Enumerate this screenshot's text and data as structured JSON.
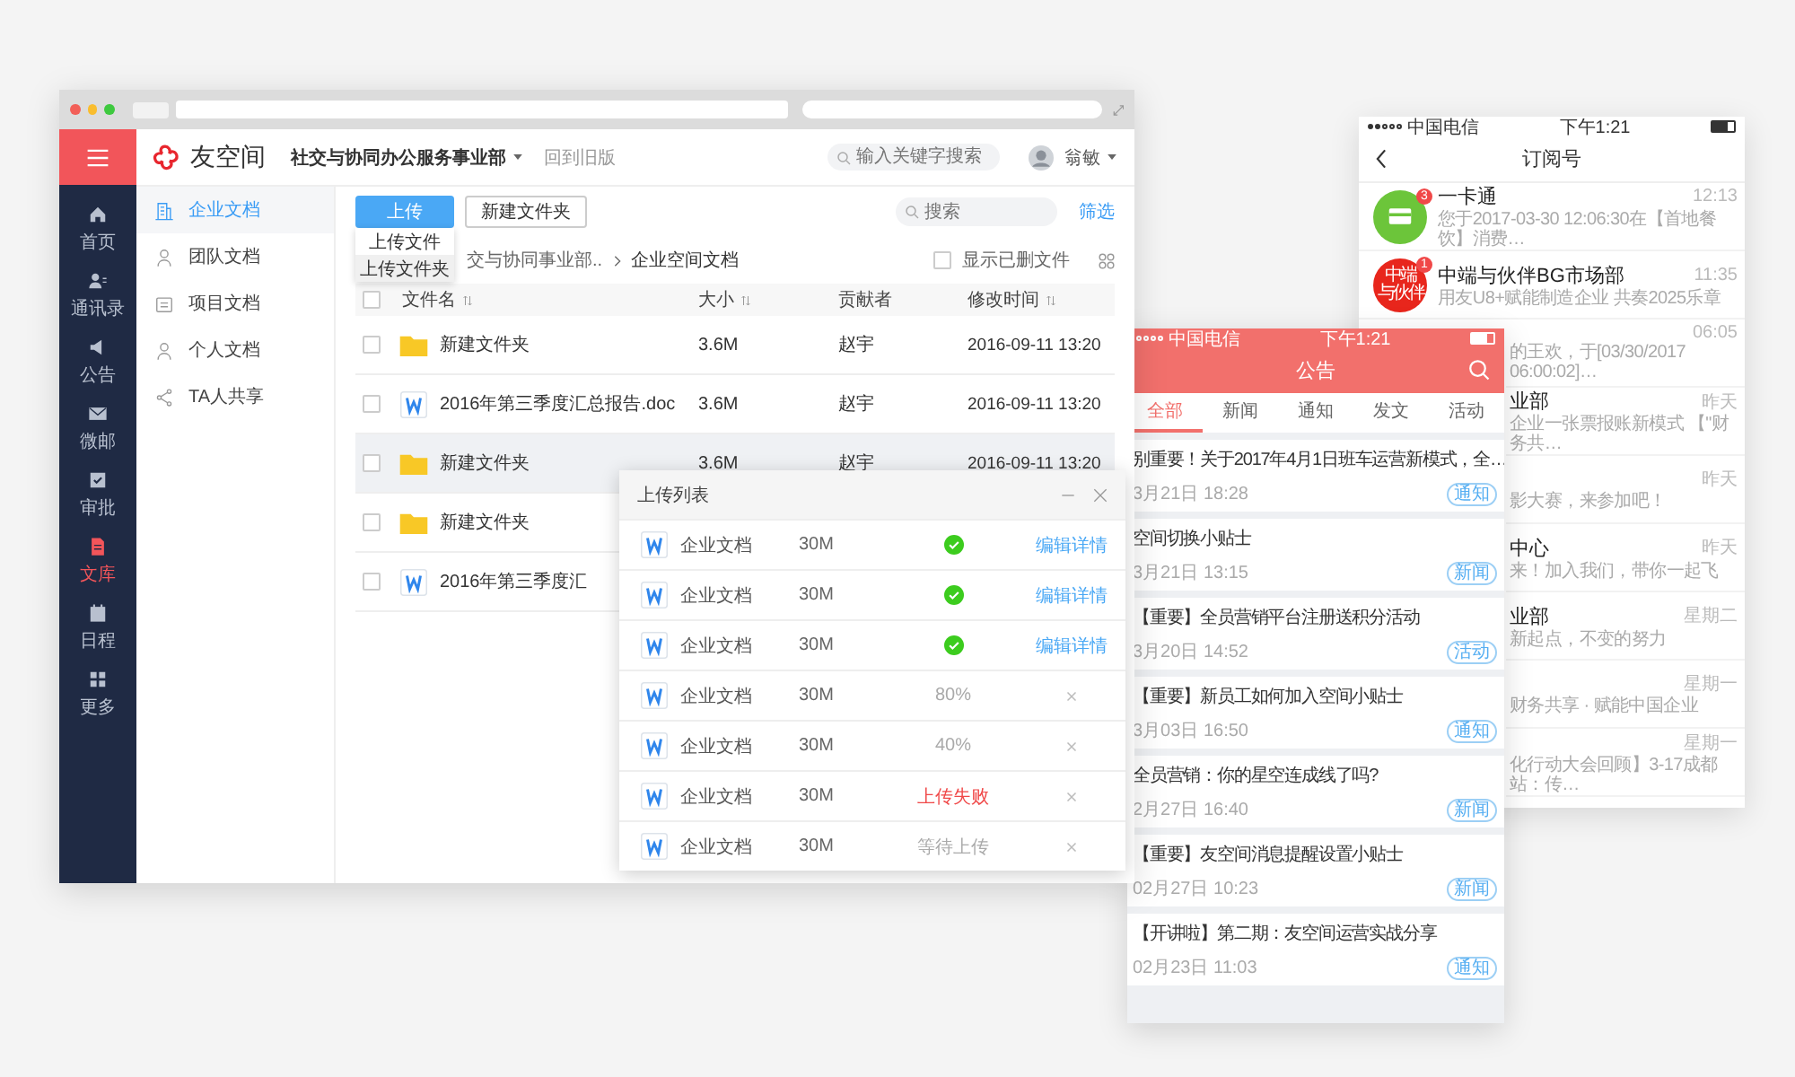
{
  "desktop": {
    "header": {
      "logo": "友空间",
      "org": "社交与协同办公服务事业部",
      "back_old": "回到旧版",
      "search_placeholder": "输入关键字搜索",
      "user": "翁敏"
    },
    "nav": [
      {
        "label": "首页",
        "selected": false
      },
      {
        "label": "通讯录",
        "selected": false
      },
      {
        "label": "公告",
        "selected": false
      },
      {
        "label": "微邮",
        "selected": false
      },
      {
        "label": "审批",
        "selected": false
      },
      {
        "label": "文库",
        "selected": true
      },
      {
        "label": "日程",
        "selected": false
      },
      {
        "label": "更多",
        "selected": false
      }
    ],
    "doc_nav": [
      {
        "label": "企业文档",
        "selected": true
      },
      {
        "label": "团队文档",
        "selected": false
      },
      {
        "label": "项目文档",
        "selected": false
      },
      {
        "label": "个人文档",
        "selected": false
      },
      {
        "label": "TA人共享",
        "selected": false
      }
    ],
    "toolbar": {
      "upload": "上传",
      "new_folder": "新建文件夹",
      "search_placeholder": "搜索",
      "filter": "筛选"
    },
    "upload_menu": [
      {
        "label": "上传文件",
        "hovered": false
      },
      {
        "label": "上传文件夹",
        "hovered": true
      }
    ],
    "breadcrumb": [
      "交与协同事业部..",
      "企业空间文档"
    ],
    "show_deleted": {
      "label": "显示已删文件",
      "checked": false
    },
    "select_all": {
      "checked": false
    },
    "columns": [
      {
        "label": "文件名",
        "sortable": true
      },
      {
        "label": "大小",
        "sortable": true
      },
      {
        "label": "贡献者",
        "sortable": false
      },
      {
        "label": "修改时间",
        "sortable": true
      }
    ],
    "files": [
      {
        "kind": "folder",
        "name": "新建文件夹",
        "size": "3.6M",
        "owner": "赵宇",
        "modified": "2016-09-11 13:20",
        "hovered": false
      },
      {
        "kind": "word",
        "name": "2016年第三季度汇总报告.doc",
        "size": "3.6M",
        "owner": "赵宇",
        "modified": "2016-09-11 13:20",
        "hovered": false
      },
      {
        "kind": "folder",
        "name": "新建文件夹",
        "size": "3.6M",
        "owner": "赵宇",
        "modified": "2016-09-11 13:20",
        "hovered": true
      },
      {
        "kind": "folder",
        "name": "新建文件夹",
        "hovered": false
      },
      {
        "kind": "word",
        "name": "2016年第三季度汇",
        "hovered": false
      }
    ],
    "upload_list": {
      "title": "上传列表",
      "items": [
        {
          "name": "企业文档",
          "size": "30M",
          "kind": "done",
          "action": "编辑详情"
        },
        {
          "name": "企业文档",
          "size": "30M",
          "kind": "done",
          "action": "编辑详情"
        },
        {
          "name": "企业文档",
          "size": "30M",
          "kind": "done",
          "action": "编辑详情"
        },
        {
          "name": "企业文档",
          "size": "30M",
          "kind": "progress",
          "status_text": "80%"
        },
        {
          "name": "企业文档",
          "size": "30M",
          "kind": "progress",
          "status_text": "40%"
        },
        {
          "name": "企业文档",
          "size": "30M",
          "kind": "failed",
          "status_text": "上传失败"
        },
        {
          "name": "企业文档",
          "size": "30M",
          "kind": "waiting",
          "status_text": "等待上传"
        }
      ]
    }
  },
  "announcement_phone": {
    "carrier": "中国电信",
    "time": "下午1:21",
    "title": "公告",
    "tabs": [
      {
        "label": "全部",
        "selected": true
      },
      {
        "label": "新闻",
        "selected": false
      },
      {
        "label": "通知",
        "selected": false
      },
      {
        "label": "发文",
        "selected": false
      },
      {
        "label": "活动",
        "selected": false
      }
    ],
    "posts": [
      {
        "title": "别重要！关于2017年4月1日班车运营新模式，全…",
        "date": "3月21日 18:28",
        "tag": "通知"
      },
      {
        "title": "空间切换小贴士",
        "date": "3月21日 13:15",
        "tag": "新闻"
      },
      {
        "title": "【重要】全员营销平台注册送积分活动",
        "date": "3月20日 14:52",
        "tag": "活动"
      },
      {
        "title": "【重要】新员工如何加入空间小贴士",
        "date": "3月03日 16:50",
        "tag": "通知"
      },
      {
        "title": "全员营销：你的星空连成线了吗?",
        "date": "2月27日 16:40",
        "tag": "新闻"
      },
      {
        "title": "【重要】友空间消息提醒设置小贴士",
        "date": "02月27日 10:23",
        "tag": "新闻"
      },
      {
        "title": "【开讲啦】第二期：友空间运营实战分享",
        "date": "02月23日 11:03",
        "tag": "通知"
      }
    ]
  },
  "subscription_phone": {
    "carrier": "中国电信",
    "time": "下午1:21",
    "title": "订阅号",
    "items": [
      {
        "kind": "full",
        "color": "#6cc53a",
        "badge": "3",
        "title": "一卡通",
        "time": "12:13",
        "preview": "您于2017-03-30 12:06:30在【首地餐饮】消费…"
      },
      {
        "kind": "full",
        "color": "#e8261c",
        "avatar_lines": [
          "中端",
          "与伙伴"
        ],
        "badge": "1",
        "title": "中端与伙伴BG市场部",
        "time": "11:35",
        "preview": "用友U8+赋能制造企业 共奏2025乐章"
      },
      {
        "kind": "partial",
        "time": "06:05",
        "preview": "的王欢，于[03/30/2017 06:00:02]…"
      },
      {
        "kind": "partial",
        "title": "业部",
        "time": "昨天",
        "preview": "企业一张票报账新模式 【\"财务共…"
      },
      {
        "kind": "partial",
        "time": "昨天",
        "preview": "影大赛，来参加吧！"
      },
      {
        "kind": "partial",
        "title": "中心",
        "time": "昨天",
        "preview": "来！加入我们，带你一起飞"
      },
      {
        "kind": "partial",
        "title": "业部",
        "time": "星期二",
        "preview": "新起点，不变的努力"
      },
      {
        "kind": "partial",
        "time": "星期一",
        "preview": "财务共享 · 赋能中国企业"
      },
      {
        "kind": "partial",
        "time": "星期一",
        "preview": "化行动大会回顾】3-17成都站：传…"
      }
    ]
  }
}
